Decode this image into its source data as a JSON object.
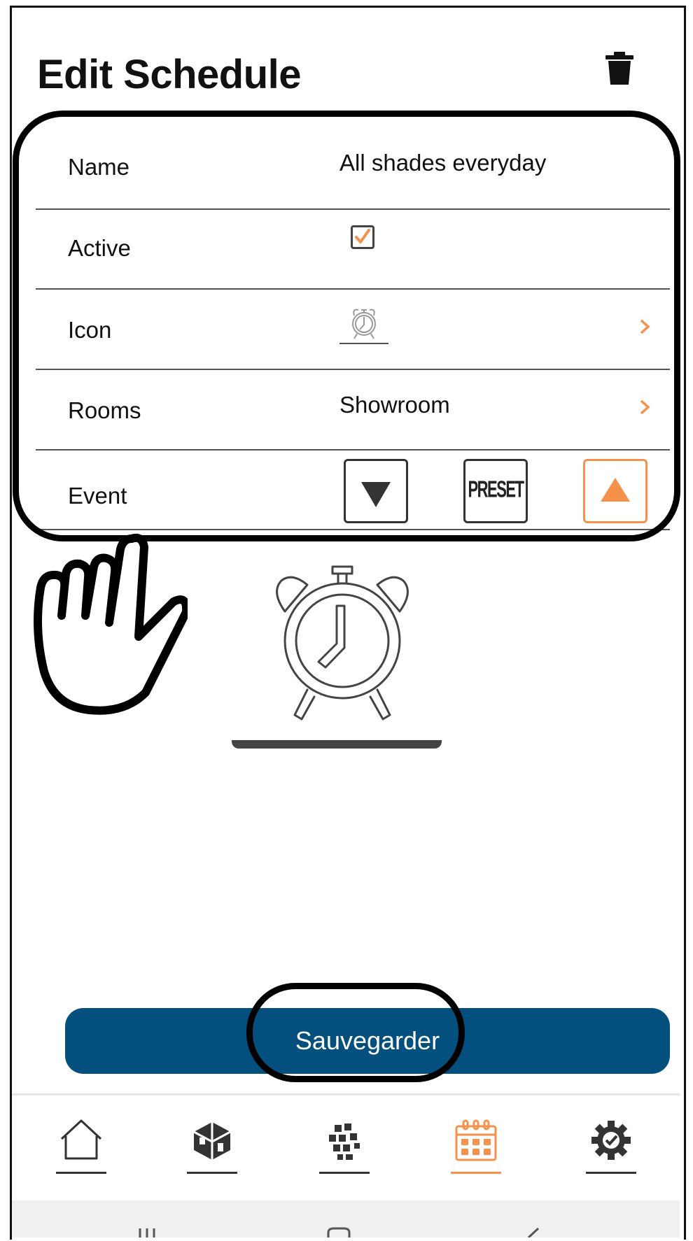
{
  "header": {
    "title": "Edit Schedule",
    "delete_icon": "trash-icon"
  },
  "form": {
    "name": {
      "label": "Name",
      "value": "All shades everyday"
    },
    "active": {
      "label": "Active",
      "checked": true
    },
    "icon": {
      "label": "Icon",
      "value_icon": "alarm-clock-icon"
    },
    "rooms": {
      "label": "Rooms",
      "value": "Showroom"
    },
    "event": {
      "label": "Event",
      "options": [
        "down",
        "PRESET",
        "up"
      ],
      "selected": "up"
    }
  },
  "preview_icon": "alarm-clock-icon",
  "save": {
    "label": "Sauvegarder"
  },
  "nav": {
    "items": [
      {
        "icon": "home-icon"
      },
      {
        "icon": "rooms-cube-icon"
      },
      {
        "icon": "scenes-grid-icon"
      },
      {
        "icon": "calendar-icon",
        "active": true
      },
      {
        "icon": "settings-gear-icon"
      }
    ]
  },
  "colors": {
    "accent": "#f5914a",
    "primary": "#034f7e",
    "text": "#111111",
    "divider": "#555555"
  }
}
